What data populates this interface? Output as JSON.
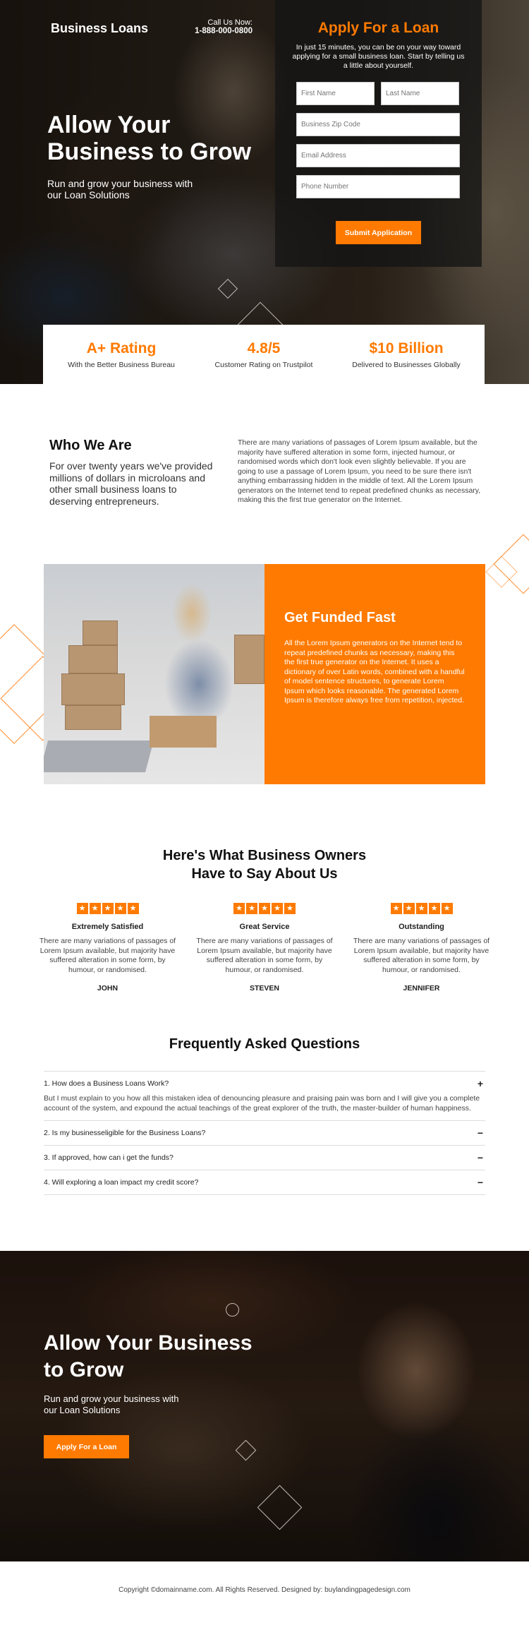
{
  "colors": {
    "accent": "#ff7a00"
  },
  "header": {
    "brand": "Business Loans",
    "call_label": "Call Us Now:",
    "phone": "1-888-000-0800"
  },
  "hero": {
    "title": "Allow Your Business to Grow",
    "subtitle": "Run and grow your business with our Loan Solutions"
  },
  "form": {
    "title": "Apply For a Loan",
    "description": "In just 15 minutes, you can be on your way toward applying for a small business loan. Start by telling us a little about yourself.",
    "fields": {
      "first_name": {
        "placeholder": "First Name",
        "value": ""
      },
      "last_name": {
        "placeholder": "Last Name",
        "value": ""
      },
      "zip": {
        "placeholder": "Business Zip Code",
        "value": ""
      },
      "email": {
        "placeholder": "Email Address",
        "value": ""
      },
      "phone": {
        "placeholder": "Phone Number",
        "value": ""
      }
    },
    "submit_label": "Submit Application"
  },
  "stats": [
    {
      "value": "A+ Rating",
      "label": "With the Better Business Bureau"
    },
    {
      "value": "4.8/5",
      "label": "Customer Rating on Trustpilot"
    },
    {
      "value": "$10 Billion",
      "label": "Delivered to Businesses Globally"
    }
  ],
  "who": {
    "title": "Who We Are",
    "lead": "For over twenty years we've provided millions of dollars in microloans and other small business loans to deserving entrepreneurs.",
    "body": "There are many variations of passages of Lorem Ipsum available, but the majority have suffered alteration in some form, injected humour, or randomised words which don't look even slightly believable. If you are going to use a passage of Lorem Ipsum, you need to be sure there isn't anything embarrassing hidden in the middle of text. All the Lorem Ipsum generators on the Internet tend to repeat predefined chunks as necessary, making this the first true generator on the Internet."
  },
  "funded": {
    "title": "Get Funded Fast",
    "body": "All the Lorem Ipsum generators on the Internet tend to repeat predefined chunks as necessary, making this the first true generator on the Internet. It uses a dictionary of over Latin words, combined with a handful of model sentence structures, to generate Lorem Ipsum which looks reasonable. The generated Lorem Ipsum is therefore always free from repetition, injected."
  },
  "testimonials": {
    "title": "Here's What Business Owners Have to Say About Us",
    "items": [
      {
        "rating": 5,
        "star_glyph": "★",
        "heading": "Extremely Satisfied",
        "text": "There are many variations of passages of Lorem Ipsum available, but majority have suffered alteration in some form, by humour, or randomised.",
        "name": "JOHN"
      },
      {
        "rating": 5,
        "star_glyph": "★",
        "heading": "Great Service",
        "text": "There are many variations of passages of Lorem Ipsum available, but majority have suffered alteration in some form, by humour, or randomised.",
        "name": "STEVEN"
      },
      {
        "rating": 5,
        "star_glyph": "★",
        "heading": "Outstanding",
        "text": "There are many variations of passages of Lorem Ipsum available, but majority have suffered alteration in some form, by humour, or randomised.",
        "name": "JENNIFER"
      }
    ]
  },
  "faq": {
    "title": "Frequently Asked Questions",
    "items": [
      {
        "question": "1. How does a Business Loans Work?",
        "toggle": "+",
        "answer": "But I must explain to you how all this mistaken idea of denouncing pleasure and praising pain was born and I will give you a complete account of the system, and expound the actual teachings of the great explorer of the truth, the master-builder of human happiness."
      },
      {
        "question": "2. Is my businesseligible for the Business Loans?",
        "toggle": "−"
      },
      {
        "question": "3. If approved, how can i get the funds?",
        "toggle": "−"
      },
      {
        "question": "4. Will exploring a loan impact my credit score?",
        "toggle": "−"
      }
    ]
  },
  "cta": {
    "title": "Allow Your Business to Grow",
    "subtitle": "Run and grow your business with our Loan Solutions",
    "button_label": "Apply For a Loan"
  },
  "footer": {
    "text": "Copyright ©domainname.com. All Rights Reserved. Designed by: buylandingpagedesign.com"
  }
}
